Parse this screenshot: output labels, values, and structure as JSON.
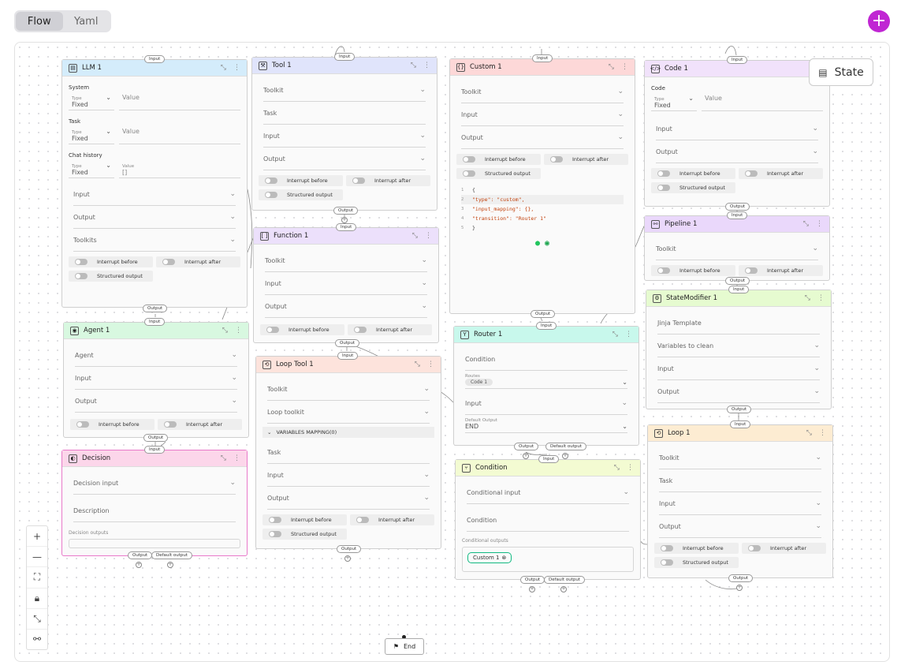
{
  "tabs": [
    {
      "label": "Flow",
      "active": true
    },
    {
      "label": "Yaml",
      "active": false
    }
  ],
  "state_button": "State",
  "end_node": "End",
  "labels": {
    "input": "Input",
    "output": "Output",
    "default_output": "Default output",
    "toolkit": "Toolkit",
    "task": "Task",
    "agent": "Agent",
    "interrupt_before": "Interrupt before",
    "interrupt_after": "Interrupt after",
    "structured_output": "Structured output",
    "type": "Type",
    "value": "Value",
    "fixed": "Fixed"
  },
  "nodes": {
    "llm": {
      "title": "LLM 1",
      "system": "System",
      "task": "Task",
      "chat_history": "Chat history",
      "chat_value": "[]",
      "toolkits": "Toolkits"
    },
    "tool": {
      "title": "Tool 1"
    },
    "function": {
      "title": "Function 1"
    },
    "loop_tool": {
      "title": "Loop Tool 1",
      "loop_toolkit": "Loop toolkit",
      "variables_mapping": "VARIABLES MAPPING(0)"
    },
    "custom": {
      "title": "Custom 1",
      "code_lines": [
        "{",
        "\"type\": \"custom\",",
        "\"input_mapping\": {},",
        "\"transition\": \"Router 1\"",
        "}"
      ]
    },
    "code": {
      "title": "Code 1",
      "code": "Code"
    },
    "pipeline": {
      "title": "Pipeline 1"
    },
    "state_modifier": {
      "title": "StateModifier 1",
      "jinja": "Jinja Template",
      "variables_to_clean": "Variables to clean"
    },
    "agent": {
      "title": "Agent 1"
    },
    "decision": {
      "title": "Decision",
      "decision_input": "Decision input",
      "description": "Description",
      "decision_outputs": "Decision outputs"
    },
    "router": {
      "title": "Router 1",
      "condition": "Condition",
      "routes": "Routes",
      "route_chip": "Code 1",
      "default_output": "Default Output",
      "default_value": "END"
    },
    "condition": {
      "title": "Condition",
      "conditional_input": "Conditional input",
      "condition": "Condition",
      "conditional_outputs": "Conditional outputs",
      "output_chip": "Custom 1"
    },
    "loop": {
      "title": "Loop 1"
    }
  },
  "colors": {
    "llm": "#d4ecfb",
    "tool": "#e0e4fb",
    "function": "#ece0fb",
    "loop_tool": "#fde3dc",
    "custom": "#fdd8d8",
    "code": "#f1e2fb",
    "pipeline": "#ead8fb",
    "state_modifier": "#e6fbd0",
    "agent": "#d8f8e0",
    "decision": "#fcd6ea",
    "router": "#c8f8ec",
    "condition": "#f3fbd2",
    "loop": "#fdecd2",
    "accent": "#c026d3"
  }
}
